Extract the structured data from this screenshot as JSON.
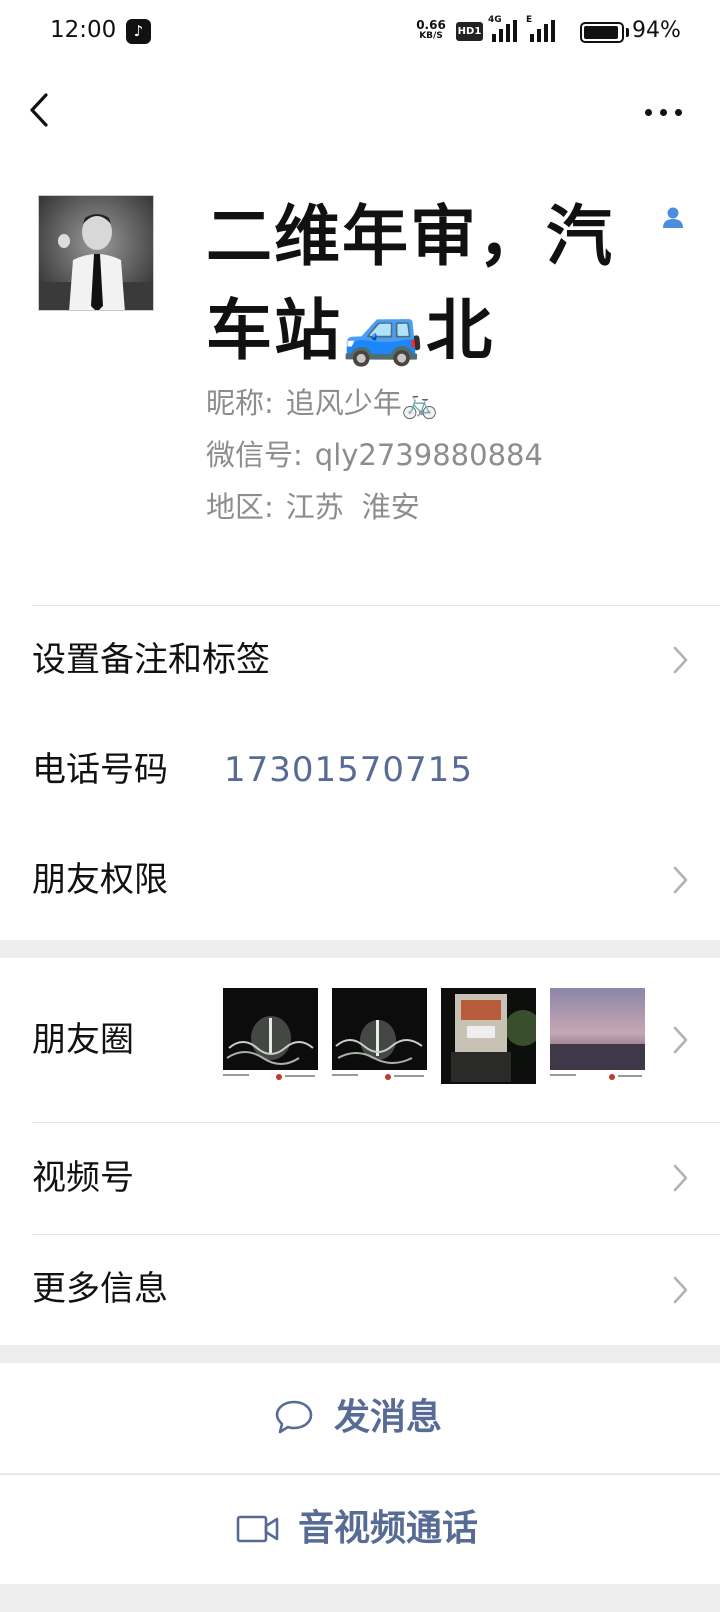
{
  "status_bar": {
    "time": "12:00",
    "app_icon": "tiktok-icon",
    "net_speed": "0.66",
    "net_speed_unit": "KB/S",
    "hd_badge": "HD1",
    "signal1_tag": "4G",
    "signal2_tag": "E",
    "battery_percent": "94%",
    "battery_level": 0.94
  },
  "nav": {
    "back_icon": "chevron-left-icon",
    "more_icon": "more-dots-icon"
  },
  "profile": {
    "display_name": "二维年审，汽车站🚙北",
    "contact_icon": "person-icon",
    "nickname_label": "昵称:",
    "nickname": "追风少年🚲",
    "wechat_id_label": "微信号:",
    "wechat_id": "qly2739880884",
    "region_label": "地区:",
    "region_province": "江苏",
    "region_city": "淮安"
  },
  "cells": {
    "remark_tags": "设置备注和标签",
    "phone_label": "电话号码",
    "phone_number": "17301570715",
    "friend_permissions": "朋友权限",
    "moments": "朋友圈",
    "channels": "视频号",
    "more_info": "更多信息"
  },
  "actions": {
    "send_message": "发消息",
    "av_call": "音视频通话"
  },
  "colors": {
    "link_blue": "#576b95",
    "background": "#ededed",
    "secondary_text": "#8d8d8d"
  }
}
